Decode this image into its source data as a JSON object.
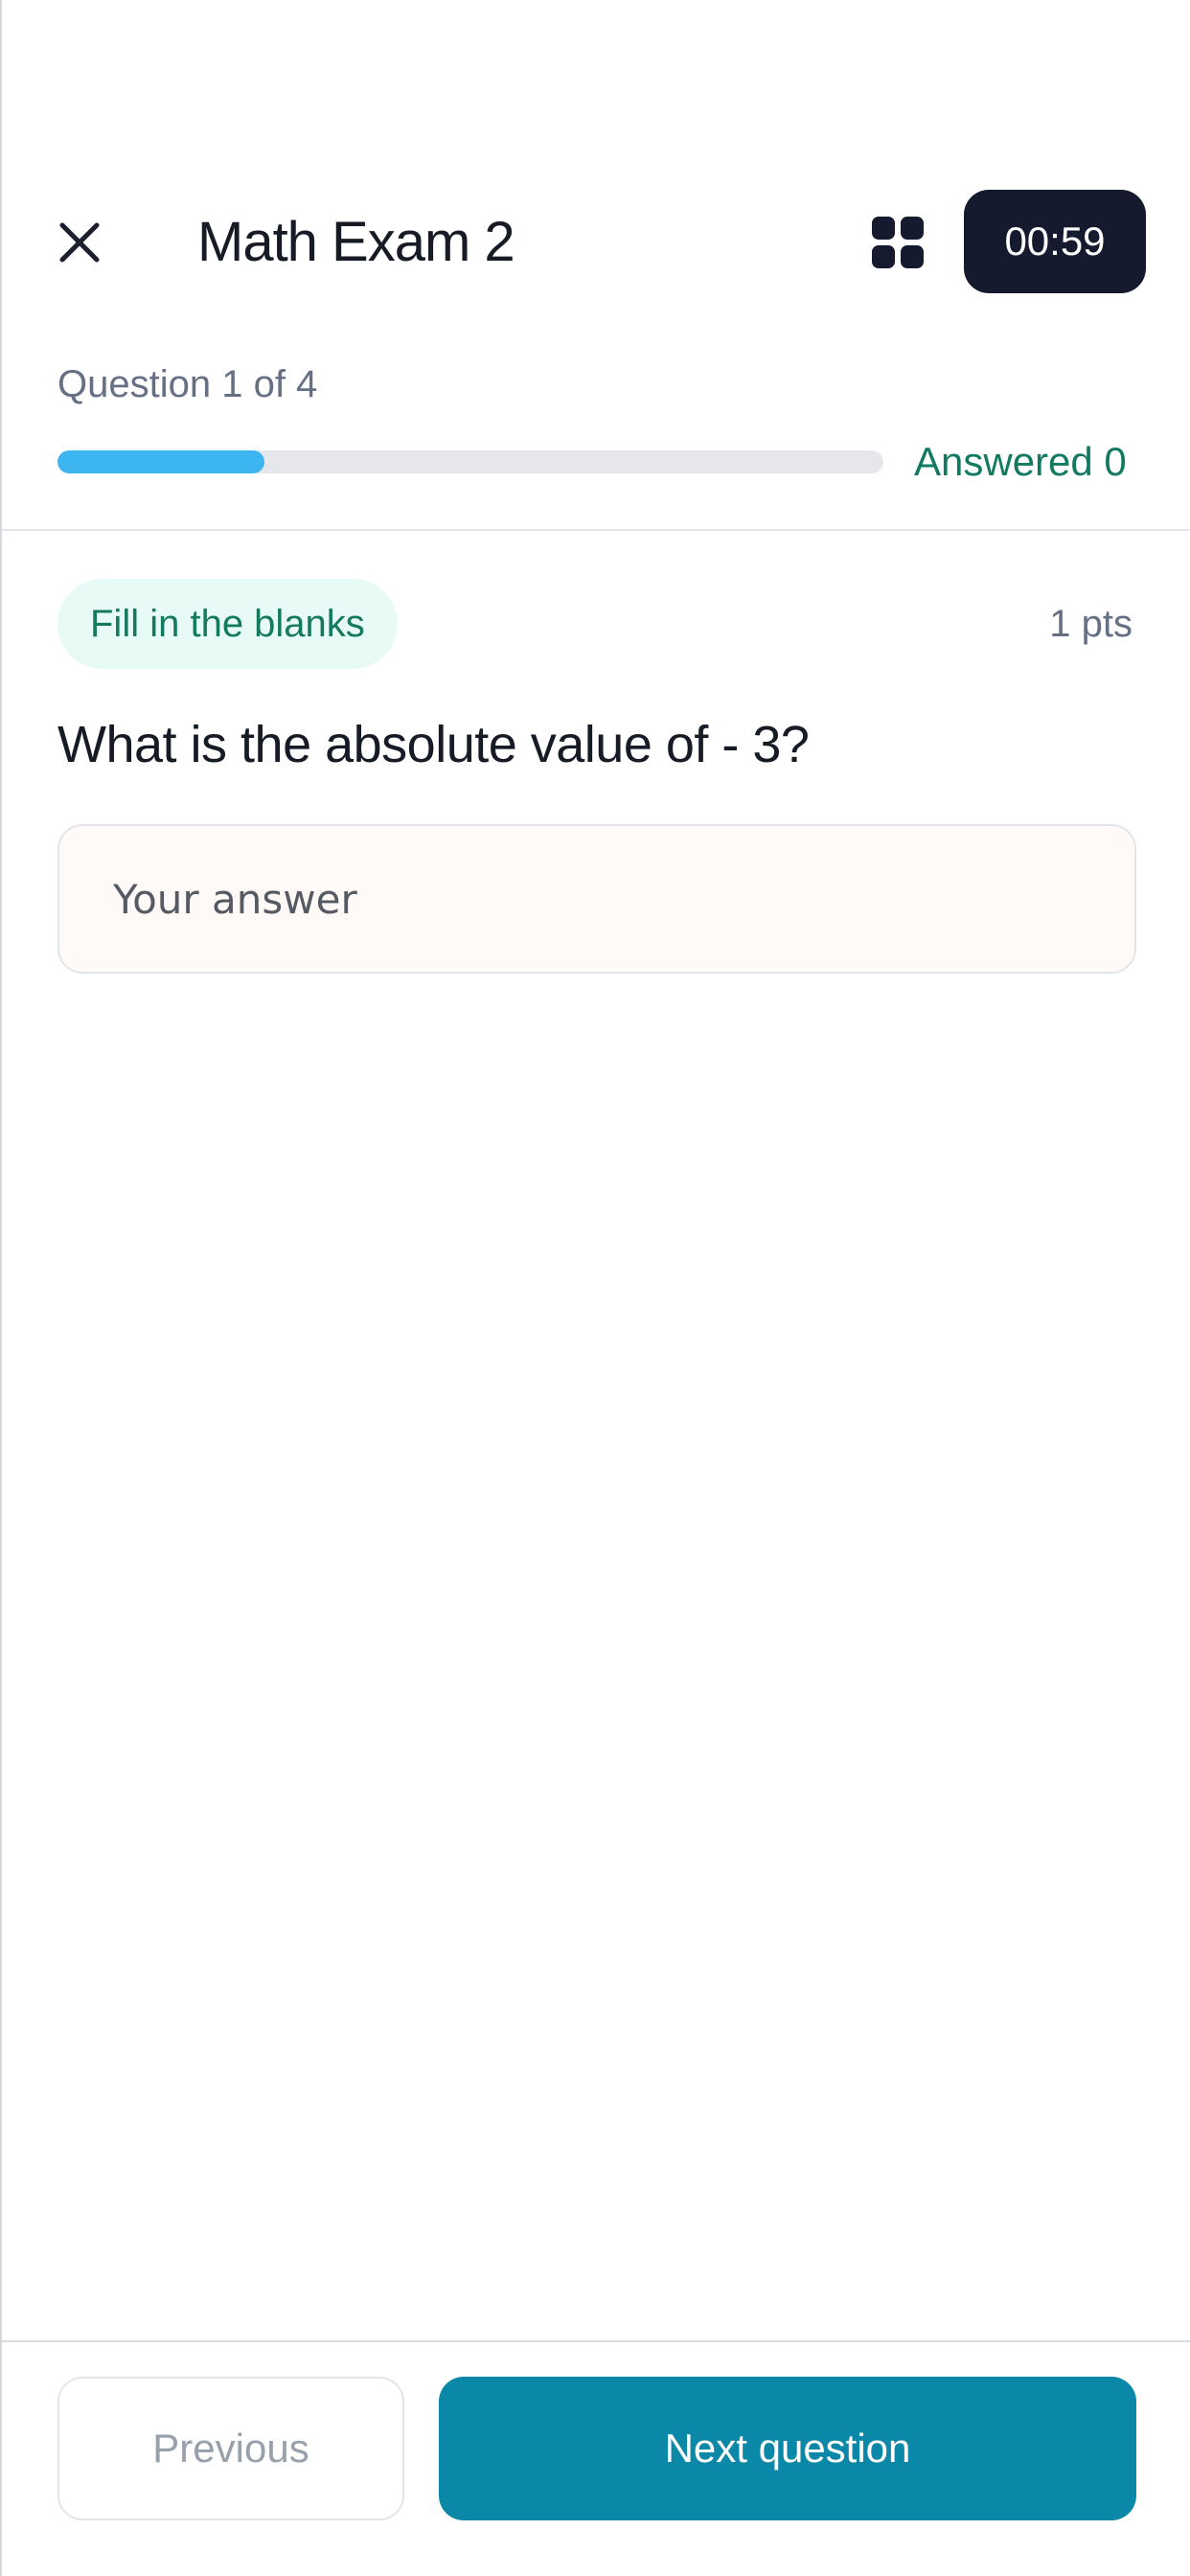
{
  "header": {
    "title": "Math Exam 2",
    "timer": "00:59",
    "close_icon": "close-icon",
    "grid_icon": "grid-icon"
  },
  "progress": {
    "counter_text": "Question 1 of 4",
    "answered_text": "Answered 0",
    "fill_fraction": 0.25,
    "fill_color": "#3cb5f0"
  },
  "question": {
    "type_badge": "Fill in the blanks",
    "points": "1 pts",
    "text": "What is the absolute value of - 3?",
    "answer_value": "",
    "answer_placeholder": "Your answer"
  },
  "footer": {
    "previous_label": "Previous",
    "next_label": "Next question",
    "next_color": "#0b87a7"
  }
}
